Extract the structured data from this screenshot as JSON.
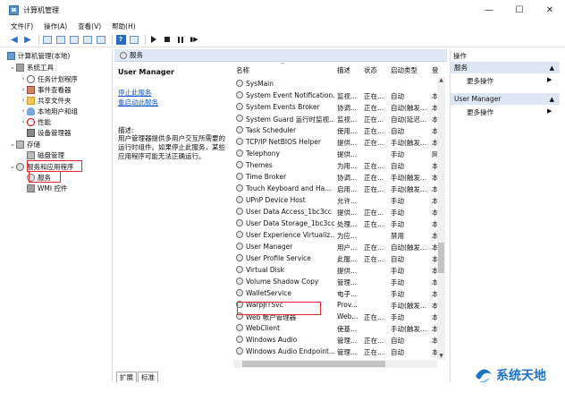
{
  "window": {
    "title": "计算机管理"
  },
  "menu": [
    "文件(F)",
    "操作(A)",
    "查看(V)",
    "帮助(H)"
  ],
  "tree": {
    "root": "计算机管理(本地)",
    "system_tools": "系统工具",
    "task_scheduler": "任务计划程序",
    "event_viewer": "事件查看器",
    "shared_folders": "共享文件夹",
    "local_users": "本地用户和组",
    "performance": "性能",
    "device_manager": "设备管理器",
    "storage": "存储",
    "disk_management": "磁盘管理",
    "services_apps": "服务和应用程序",
    "services": "服务",
    "wmi": "WMI 控件"
  },
  "center_header": "服务",
  "detail": {
    "title": "User Manager",
    "stop_link": "停止此服务",
    "restart_link": "重启动此服务",
    "desc_label": "描述:",
    "desc_text": "用户管理器提供多用户交互所需要的运行时组件。如果停止此服务，某些应用程序可能无法正确运行。"
  },
  "columns": {
    "name": "名称",
    "desc": "描述",
    "status": "状态",
    "startup": "启动类型",
    "logon": "登"
  },
  "services": [
    {
      "name": "SysMain",
      "desc": "",
      "status": "",
      "startup": "",
      "logon": ""
    },
    {
      "name": "System Event Notification...",
      "desc": "监视...",
      "status": "正在...",
      "startup": "自动",
      "logon": "本"
    },
    {
      "name": "System Events Broker",
      "desc": "协调...",
      "status": "正在...",
      "startup": "自动(触发...",
      "logon": "本"
    },
    {
      "name": "System Guard 运行时监视...",
      "desc": "监视...",
      "status": "正在...",
      "startup": "自动(延迟...",
      "logon": "本"
    },
    {
      "name": "Task Scheduler",
      "desc": "使用...",
      "status": "正在...",
      "startup": "自动",
      "logon": "本"
    },
    {
      "name": "TCP/IP NetBIOS Helper",
      "desc": "提供...",
      "status": "正在...",
      "startup": "手动(触发...",
      "logon": "本"
    },
    {
      "name": "Telephony",
      "desc": "提供...",
      "status": "",
      "startup": "手动",
      "logon": "网"
    },
    {
      "name": "Themes",
      "desc": "为用...",
      "status": "正在...",
      "startup": "自动",
      "logon": "本"
    },
    {
      "name": "Time Broker",
      "desc": "协调...",
      "status": "正在...",
      "startup": "手动(触发...",
      "logon": "本"
    },
    {
      "name": "Touch Keyboard and Ha...",
      "desc": "启用...",
      "status": "正在...",
      "startup": "手动(触发...",
      "logon": "本"
    },
    {
      "name": "UPnP Device Host",
      "desc": "允许...",
      "status": "",
      "startup": "手动",
      "logon": "本"
    },
    {
      "name": "User Data Access_1bc3cc",
      "desc": "提供...",
      "status": "正在...",
      "startup": "手动",
      "logon": "本"
    },
    {
      "name": "User Data Storage_1bc3cc",
      "desc": "处理...",
      "status": "正在...",
      "startup": "手动",
      "logon": "本"
    },
    {
      "name": "User Experience Virtualiz...",
      "desc": "为应...",
      "status": "",
      "startup": "禁用",
      "logon": "本"
    },
    {
      "name": "User Manager",
      "desc": "用户...",
      "status": "正在...",
      "startup": "自动(触发...",
      "logon": "本"
    },
    {
      "name": "User Profile Service",
      "desc": "此服...",
      "status": "正在...",
      "startup": "自动",
      "logon": "本"
    },
    {
      "name": "Virtual Disk",
      "desc": "提供...",
      "status": "",
      "startup": "手动",
      "logon": "本"
    },
    {
      "name": "Volume Shadow Copy",
      "desc": "管理...",
      "status": "",
      "startup": "手动",
      "logon": "本"
    },
    {
      "name": "WalletService",
      "desc": "电子...",
      "status": "",
      "startup": "手动",
      "logon": "本"
    },
    {
      "name": "WarpJITSvc",
      "desc": "Prov...",
      "status": "",
      "startup": "手动(触发...",
      "logon": "本"
    },
    {
      "name": "Web 帐户管理器",
      "desc": "Web...",
      "status": "正在...",
      "startup": "手动",
      "logon": "本"
    },
    {
      "name": "WebClient",
      "desc": "使基...",
      "status": "",
      "startup": "手动(触发...",
      "logon": "本"
    },
    {
      "name": "Windows Audio",
      "desc": "管理...",
      "status": "正在...",
      "startup": "自动",
      "logon": "本"
    },
    {
      "name": "Windows Audio Endpoint...",
      "desc": "管理...",
      "status": "正在...",
      "startup": "自动",
      "logon": "本"
    }
  ],
  "tabs": [
    "扩展",
    "标准"
  ],
  "actions": {
    "title": "操作",
    "section1": "服务",
    "section1_more": "更多操作",
    "section2": "User Manager",
    "section2_more": "更多操作"
  },
  "watermark": "系统天地"
}
